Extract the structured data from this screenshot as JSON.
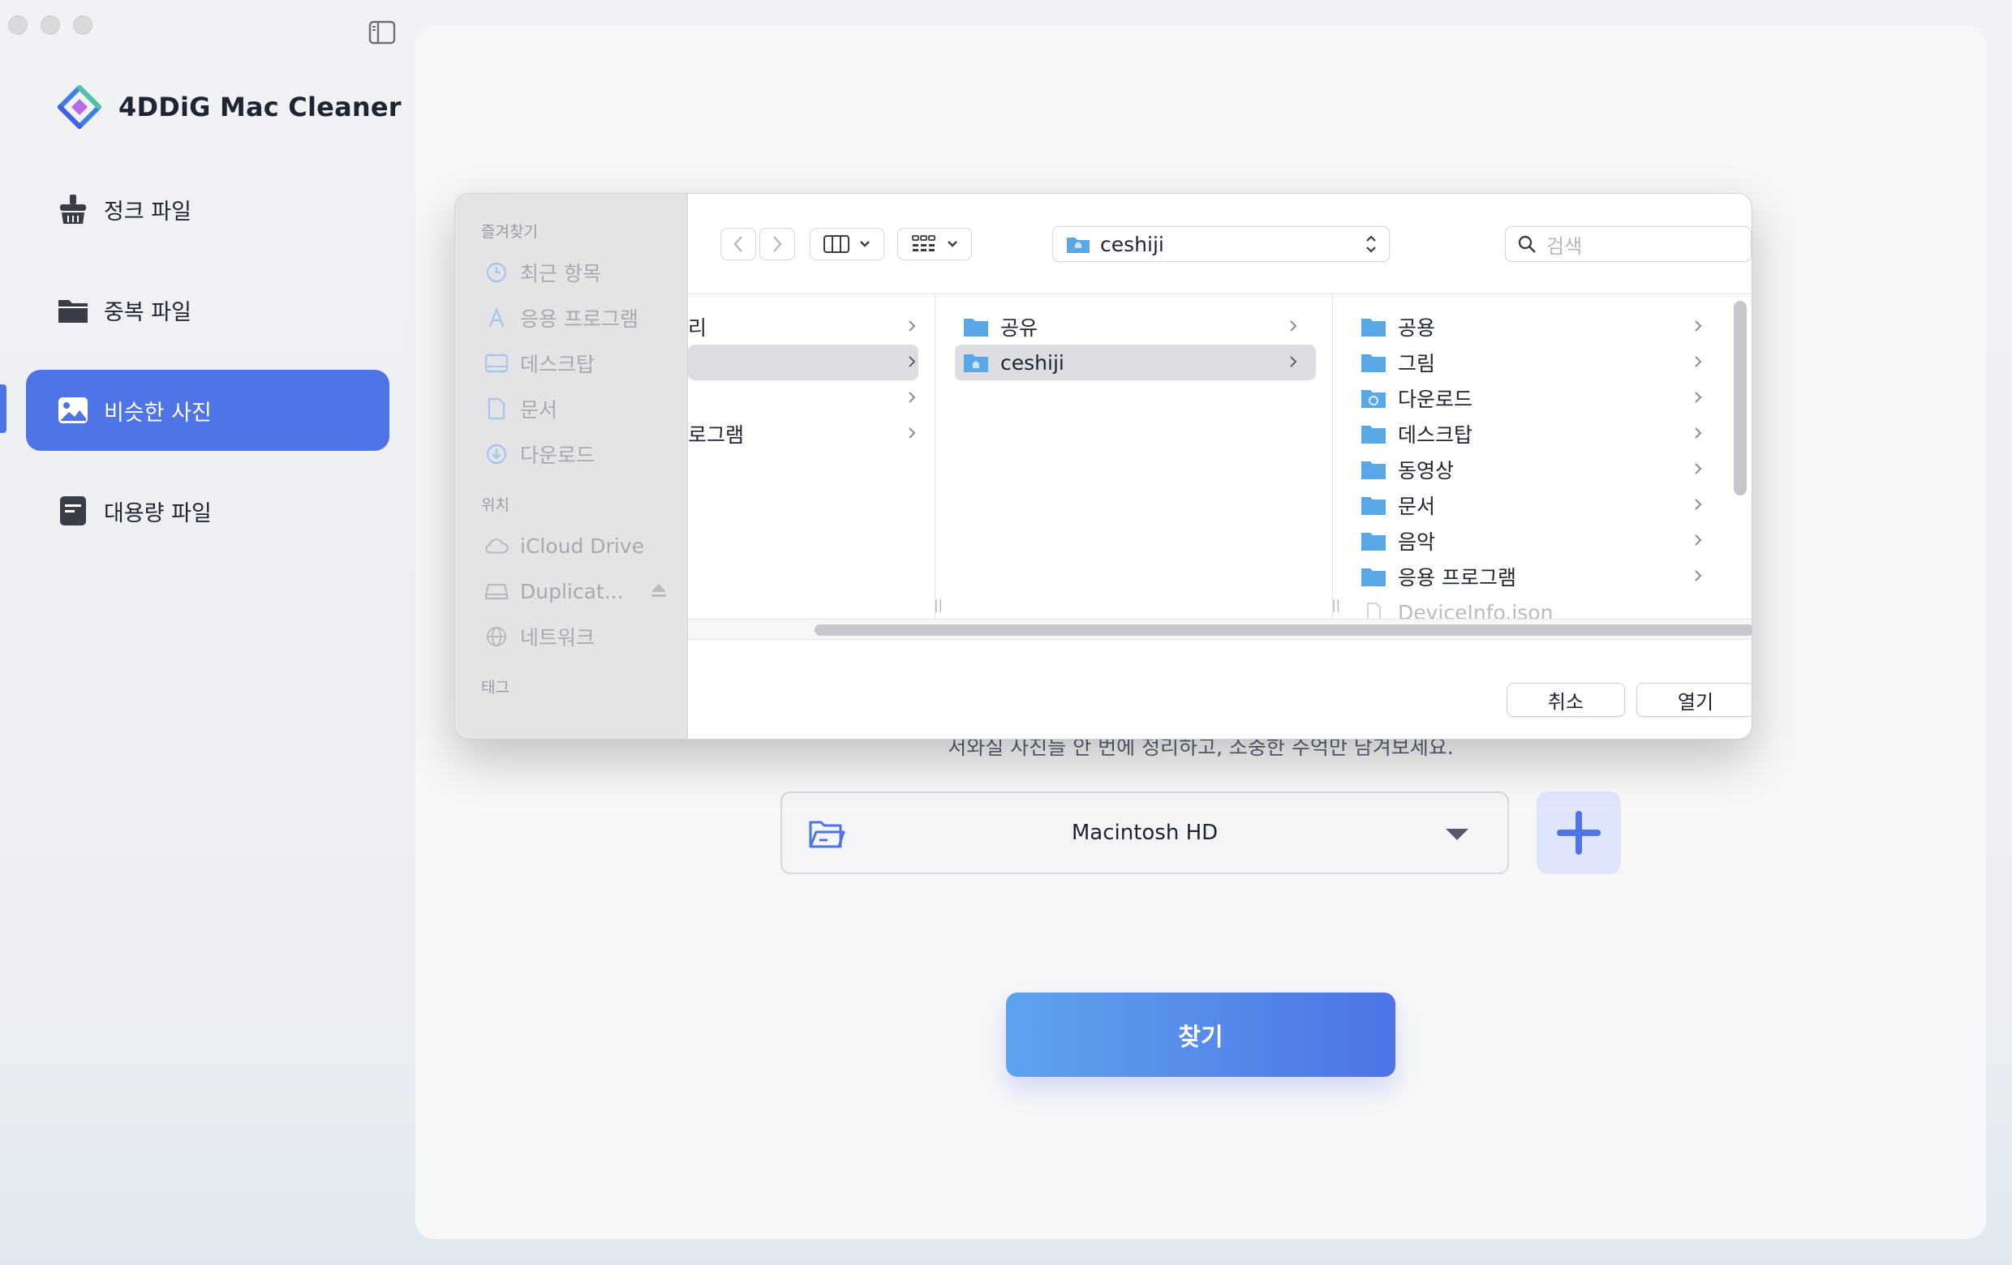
{
  "app": {
    "title": "4DDiG Mac Cleaner"
  },
  "sidebar": {
    "items": [
      {
        "label": "정크 파일",
        "icon": "broom-icon",
        "active": false
      },
      {
        "label": "중복 파일",
        "icon": "folder-icon",
        "active": false
      },
      {
        "label": "비슷한 사진",
        "icon": "photo-icon",
        "active": true
      },
      {
        "label": "대용량 파일",
        "icon": "large-file-icon",
        "active": false
      }
    ]
  },
  "main": {
    "subtitle": "서와실 사진들 안 번에 정리하고, 소중한 주억만 남겨보세요.",
    "drive": {
      "selected": "Macintosh HD"
    },
    "search_button": "찾기"
  },
  "dialog": {
    "sidebar": {
      "favorites_label": "즐겨찾기",
      "favorites": [
        "최근 항목",
        "응용 프로그램",
        "데스크탑",
        "문서",
        "다운로드"
      ],
      "locations_label": "위치",
      "locations": [
        "iCloud Drive",
        "Duplicat...",
        "네트워크"
      ],
      "tags_label": "태그"
    },
    "toolbar": {
      "path": "ceshiji",
      "search_placeholder": "검색"
    },
    "columns": {
      "col1": [
        "리",
        "",
        "",
        "로그램"
      ],
      "col2": [
        "공유",
        "ceshiji"
      ],
      "col3": [
        "공용",
        "그림",
        "다운로드",
        "데스크탑",
        "동영상",
        "문서",
        "음악",
        "응용 프로그램",
        "DeviceInfo.json"
      ]
    },
    "footer": {
      "cancel": "취소",
      "open": "열기"
    }
  },
  "colors": {
    "accent": "#4f74e6",
    "folder": "#5aa7e6"
  }
}
